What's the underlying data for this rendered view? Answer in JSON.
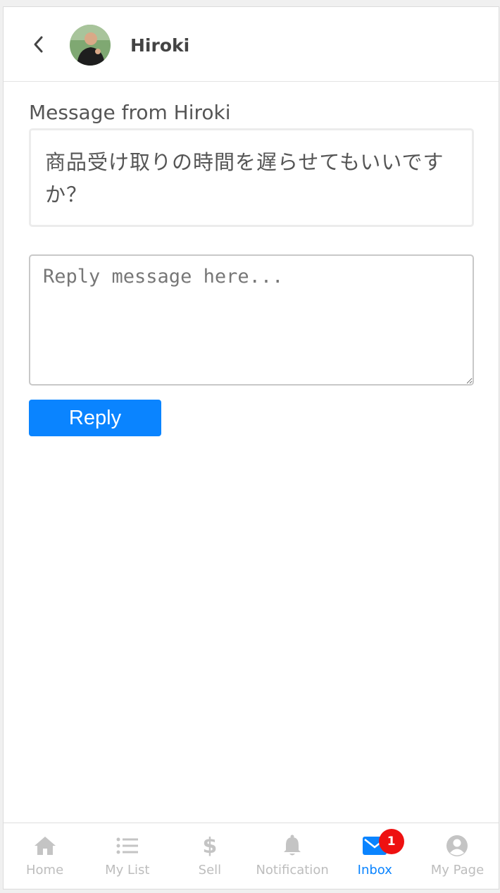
{
  "header": {
    "contact_name": "Hiroki"
  },
  "message": {
    "label": "Message from Hiroki",
    "text": "商品受け取りの時間を遅らせてもいいですか？"
  },
  "reply": {
    "placeholder": "Reply message here...",
    "value": "",
    "button_label": "Reply"
  },
  "nav": {
    "items": [
      {
        "label": "Home",
        "icon": "home-icon",
        "active": false
      },
      {
        "label": "My List",
        "icon": "list-icon",
        "active": false
      },
      {
        "label": "Sell",
        "icon": "dollar-icon",
        "active": false
      },
      {
        "label": "Notification",
        "icon": "bell-icon",
        "active": false
      },
      {
        "label": "Inbox",
        "icon": "mail-icon",
        "active": true,
        "badge": "1"
      },
      {
        "label": "My Page",
        "icon": "user-circle-icon",
        "active": false
      }
    ]
  },
  "colors": {
    "accent": "#0a84ff",
    "badge": "#ee1111",
    "inactive": "#bdbdbd"
  }
}
